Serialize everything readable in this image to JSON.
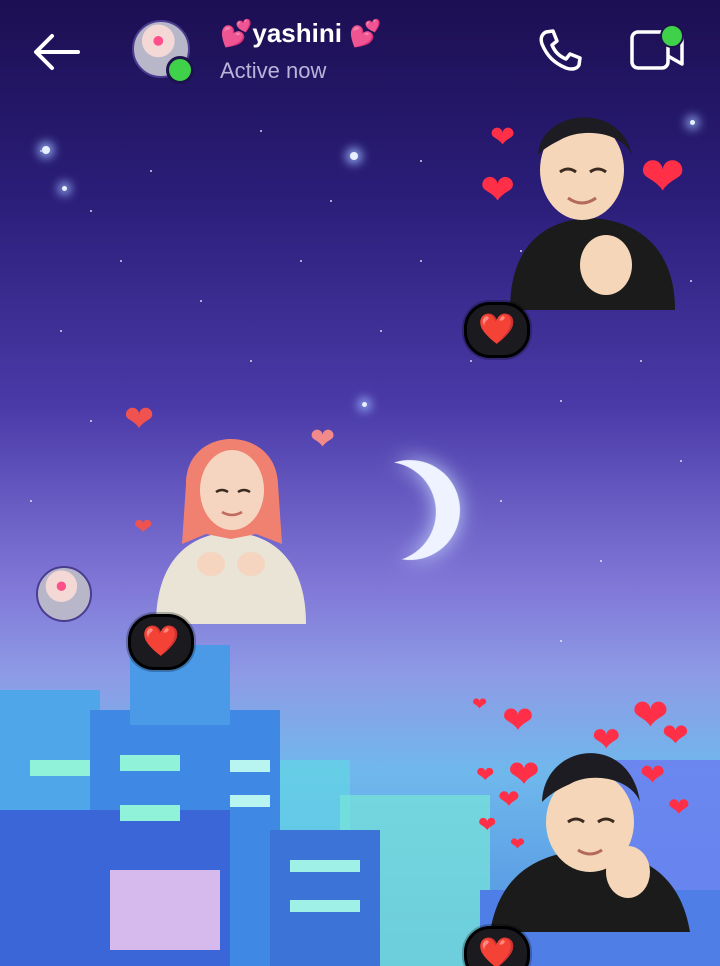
{
  "header": {
    "name": "💕yashini 💕",
    "status": "Active now"
  },
  "reaction_emoji": "❤️",
  "colors": {
    "online": "#3fd14a",
    "heart": "#ff2d3a"
  }
}
